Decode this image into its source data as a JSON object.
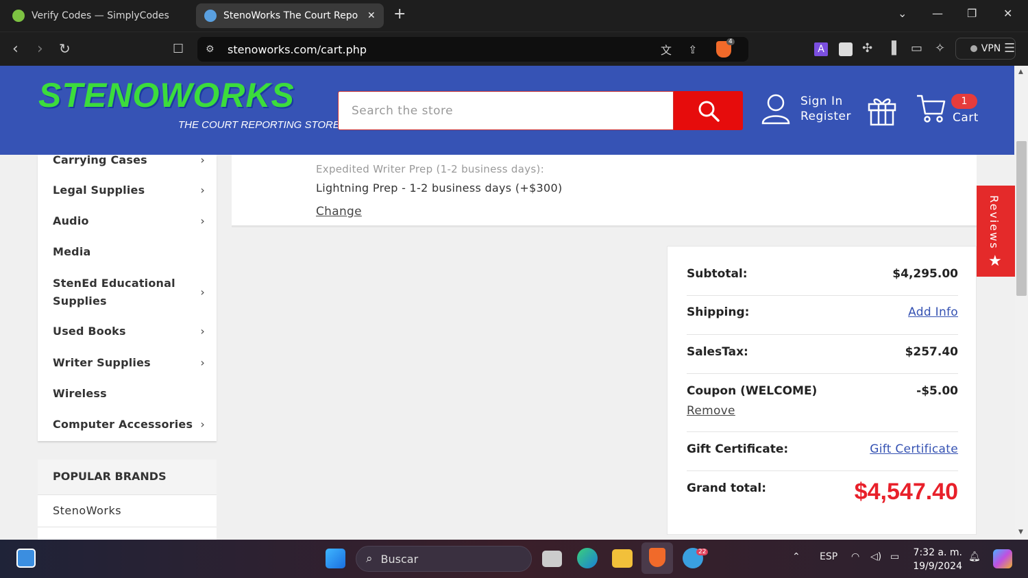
{
  "browser": {
    "tabs": [
      {
        "title": "Verify Codes — SimplyCodes",
        "active": false
      },
      {
        "title": "StenoWorks The Court Reportin",
        "active": true
      }
    ],
    "url": "stenoworks.com/cart.php",
    "vpn_label": "VPN",
    "shield_count": "4"
  },
  "header": {
    "logo_main": "STENOWORKS",
    "logo_sub": "THE COURT REPORTING STORE",
    "search_placeholder": "Search the store",
    "sign_in": "Sign In",
    "register": "Register",
    "cart_count": "1",
    "cart_label": "Cart"
  },
  "sidebar": {
    "items": [
      {
        "label": "Carrying Cases",
        "chevron": true
      },
      {
        "label": "Legal Supplies",
        "chevron": true
      },
      {
        "label": "Audio",
        "chevron": true
      },
      {
        "label": "Media",
        "chevron": false
      },
      {
        "label": "StenEd Educational Supplies",
        "chevron": true
      },
      {
        "label": "Used Books",
        "chevron": true
      },
      {
        "label": "Writer Supplies",
        "chevron": true
      },
      {
        "label": "Wireless",
        "chevron": false
      },
      {
        "label": "Computer Accessories",
        "chevron": true
      }
    ],
    "brands_heading": "POPULAR BRANDS",
    "brands": [
      "StenoWorks"
    ]
  },
  "cart_item": {
    "option_label": "Expedited Writer Prep (1-2 business days):",
    "option_value": "Lightning Prep - 1-2 business days (+$300)",
    "change_link": "Change"
  },
  "totals": {
    "subtotal_label": "Subtotal:",
    "subtotal_value": "$4,295.00",
    "shipping_label": "Shipping:",
    "shipping_link": "Add Info",
    "tax_label": "SalesTax:",
    "tax_value": "$257.40",
    "coupon_label": "Coupon (WELCOME)",
    "coupon_value": "-$5.00",
    "coupon_remove": "Remove",
    "gift_label": "Gift Certificate:",
    "gift_link": "Gift Certificate",
    "grand_label": "Grand total:",
    "grand_value": "$4,547.40"
  },
  "reviews_tab": "Reviews",
  "taskbar": {
    "search_label": "Buscar",
    "lang": "ESP",
    "time": "7:32 a. m.",
    "date": "19/9/2024",
    "telegram_badge": "22"
  },
  "colors": {
    "header_blue": "#3653b5",
    "accent_red": "#e60c0c",
    "link_blue": "#3451b2",
    "grand_total_red": "#e8202a",
    "logo_green": "#3cdc3c"
  }
}
